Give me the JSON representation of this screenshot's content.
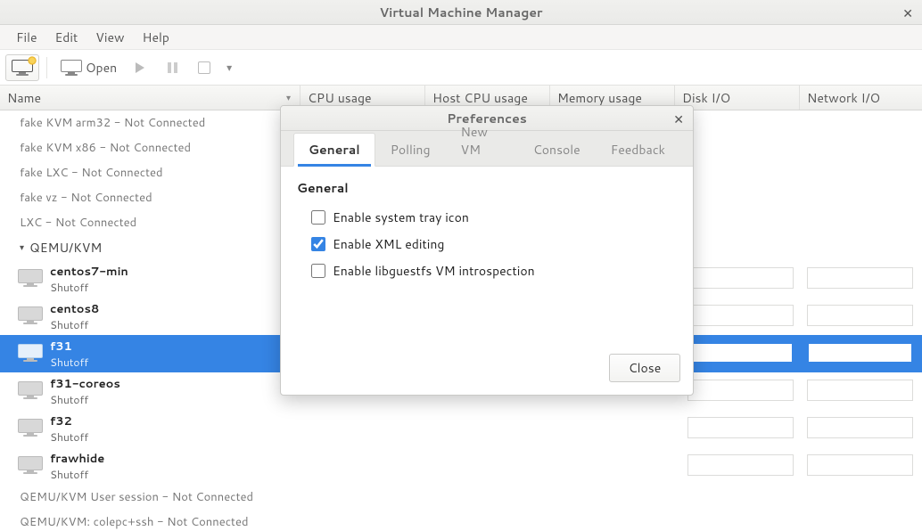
{
  "window": {
    "title": "Virtual Machine Manager"
  },
  "menus": {
    "file": "File",
    "edit": "Edit",
    "view": "View",
    "help": "Help"
  },
  "toolbar": {
    "open": "Open"
  },
  "columns": {
    "name": "Name",
    "cpu": "CPU usage",
    "hostcpu": "Host CPU usage",
    "memory": "Memory usage",
    "disk": "Disk I/O",
    "net": "Network I/O"
  },
  "connections_top": [
    "fake KVM arm32 - Not Connected",
    "fake KVM x86 - Not Connected",
    "fake LXC - Not Connected",
    "fake vz - Not Connected",
    "LXC - Not Connected"
  ],
  "group": "QEMU/KVM",
  "vms": [
    {
      "name": "centos7-min",
      "state": "Shutoff",
      "selected": false
    },
    {
      "name": "centos8",
      "state": "Shutoff",
      "selected": false
    },
    {
      "name": "f31",
      "state": "Shutoff",
      "selected": true
    },
    {
      "name": "f31-coreos",
      "state": "Shutoff",
      "selected": false
    },
    {
      "name": "f32",
      "state": "Shutoff",
      "selected": false
    },
    {
      "name": "frawhide",
      "state": "Shutoff",
      "selected": false
    }
  ],
  "connections_bottom": [
    "QEMU/KVM User session - Not Connected",
    "QEMU/KVM: colepc+ssh - Not Connected"
  ],
  "modal": {
    "title": "Preferences",
    "tabs": {
      "general": "General",
      "polling": "Polling",
      "newvm": "New VM",
      "console": "Console",
      "feedback": "Feedback"
    },
    "section": "General",
    "opts": {
      "tray": {
        "label": "Enable system tray icon",
        "checked": false
      },
      "xml": {
        "label": "Enable XML editing",
        "checked": true
      },
      "libguestfs": {
        "label": "Enable libguestfs VM introspection",
        "checked": false
      }
    },
    "close": "Close"
  }
}
